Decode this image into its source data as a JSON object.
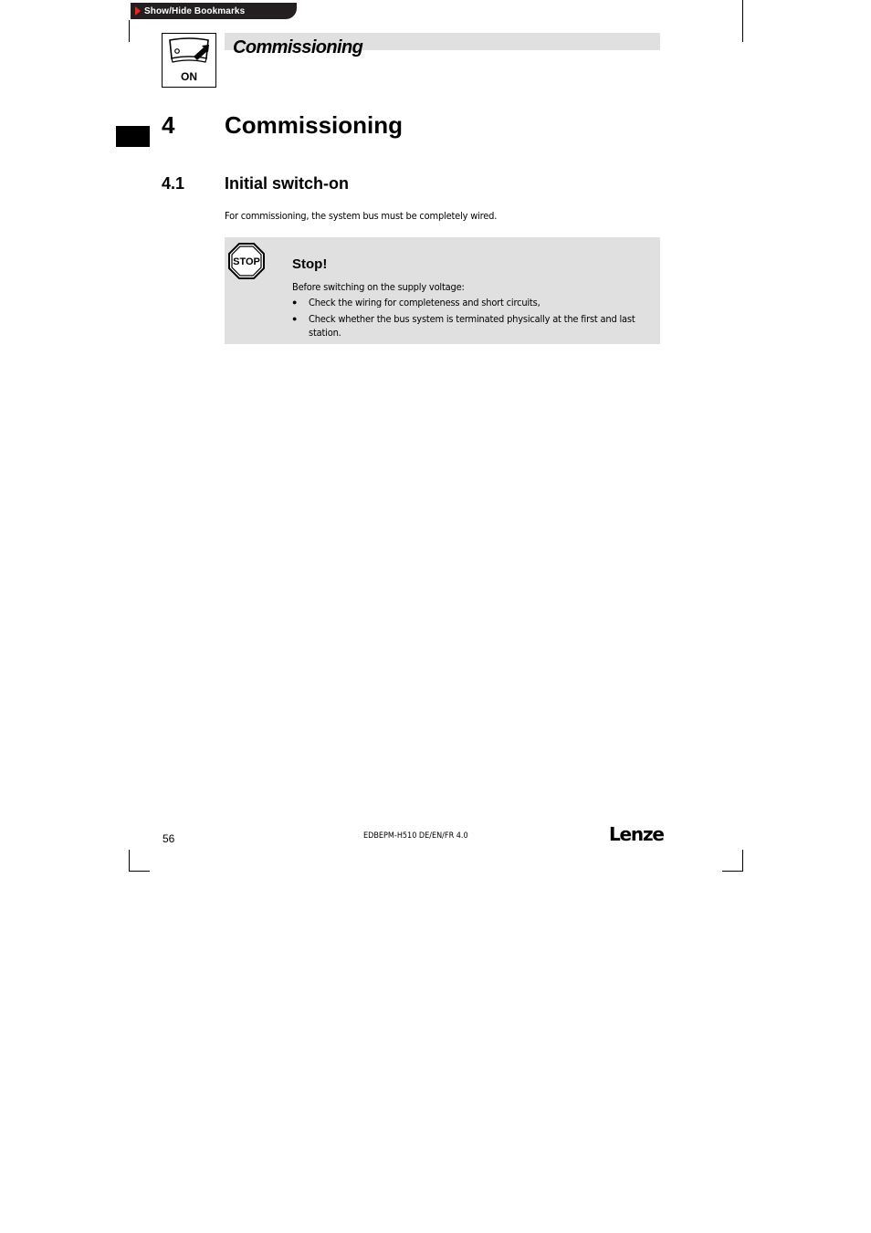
{
  "toolbar": {
    "bookmarks_label": "Show/Hide Bookmarks",
    "bookmarks_icon": "triangle-right-icon",
    "arrow_color": "#e02a1f"
  },
  "header": {
    "icon_label": "ON",
    "icon": "power-switch-icon",
    "running_title": "Commissioning",
    "band_color": "#e0e0e0"
  },
  "chapter": {
    "number": "4",
    "title": "Commissioning"
  },
  "section": {
    "number": "4.1",
    "title": "Initial switch-on",
    "body": "For commissioning, the system bus must be completely wired."
  },
  "warning": {
    "icon": "stop-sign-icon",
    "icon_text": "STOP",
    "title": "Stop!",
    "intro": "Before switching on the supply voltage:",
    "bullets": [
      "Check the wiring for completeness and short circuits,",
      "Check whether the bus system is terminated physically at the first and last station."
    ]
  },
  "footer": {
    "page_number": "56",
    "doc_code": "EDBEPM-H510 DE/EN/FR 4.0",
    "logo": "Lenze"
  }
}
